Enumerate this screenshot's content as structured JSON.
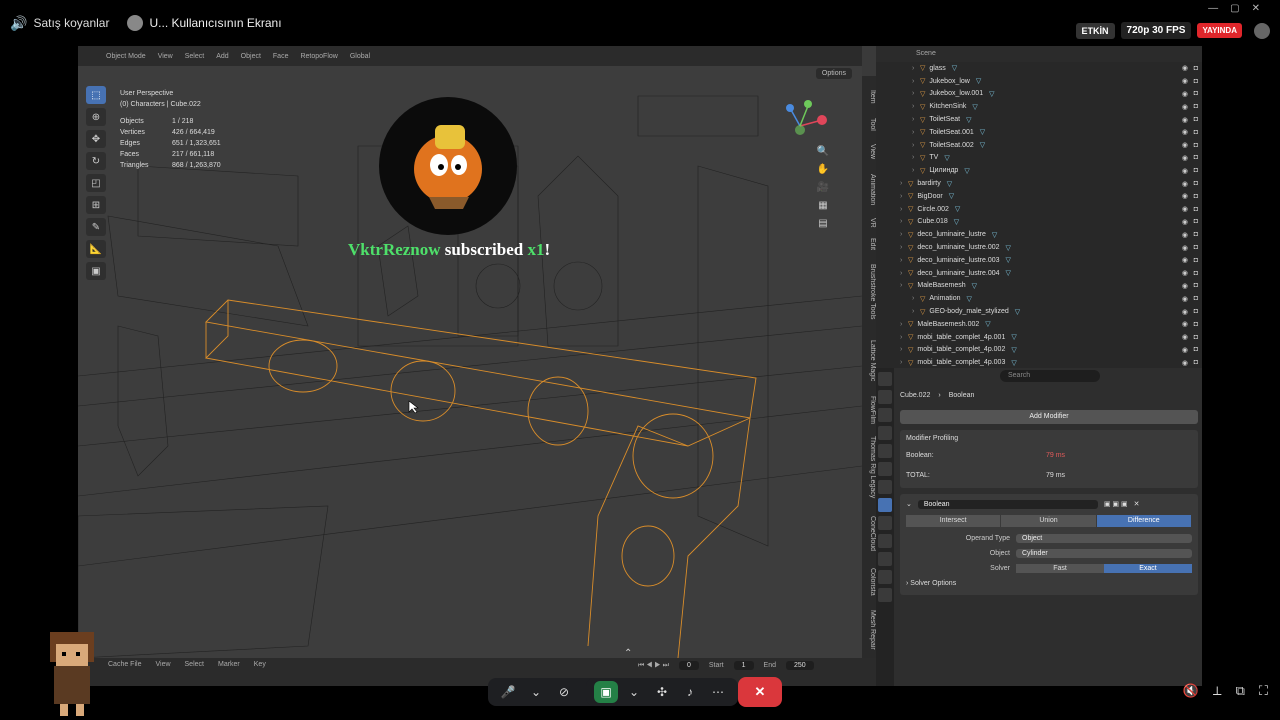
{
  "topbar": {
    "server_name": "Satış koyanlar",
    "stream_title": "U... Kullanıcısının Ekranı",
    "badge_active": "ETKİN",
    "badge_quality": "720p 30 FPS",
    "badge_live": "YAYINDA"
  },
  "viewport": {
    "mode": "Object Mode",
    "menu": [
      "View",
      "Select",
      "Add",
      "Object",
      "Face",
      "RetopoFlow"
    ],
    "transform": "Global",
    "options_label": "Options",
    "perspective": "User Perspective",
    "context": "(0) Characters | Cube.022",
    "stats": [
      {
        "label": "Objects",
        "value": "1 / 218"
      },
      {
        "label": "Vertices",
        "value": "426 / 664,419"
      },
      {
        "label": "Edges",
        "value": "651 / 1,323,651"
      },
      {
        "label": "Faces",
        "value": "217 / 661,118"
      },
      {
        "label": "Triangles",
        "value": "868 / 1,263,870"
      }
    ],
    "side_tabs": [
      "Item",
      "Tool",
      "View",
      "Animation",
      "VR",
      "Edit",
      "Brushstroke Tools",
      "Lattice Magic",
      "FlowFilm",
      "Thomas Rig Legacy",
      "ConeCloud",
      "Colorista",
      "Mesh Repair"
    ]
  },
  "alert": {
    "username": "VktrReznow",
    "message": "subscribed",
    "count": "x1",
    "suffix": "!"
  },
  "timeline": {
    "cache": "Cache File",
    "menu": [
      "View",
      "Select",
      "Marker",
      "Key"
    ],
    "current_frame": "0",
    "start_label": "Start",
    "start": "1",
    "end_label": "End",
    "end": "250"
  },
  "outliner": {
    "search_label": "Scene",
    "items": [
      {
        "name": "glass",
        "indent": 1
      },
      {
        "name": "Jukebox_low",
        "indent": 1
      },
      {
        "name": "Jukebox_low.001",
        "indent": 1
      },
      {
        "name": "KitchenSink",
        "indent": 1
      },
      {
        "name": "ToiletSeat",
        "indent": 1
      },
      {
        "name": "ToiletSeat.001",
        "indent": 1
      },
      {
        "name": "ToiletSeat.002",
        "indent": 1
      },
      {
        "name": "TV",
        "indent": 1
      },
      {
        "name": "Цилиндр",
        "indent": 1
      },
      {
        "name": "bardirty",
        "indent": 0
      },
      {
        "name": "BigDoor",
        "indent": 0
      },
      {
        "name": "Circle.002",
        "indent": 0
      },
      {
        "name": "Cube.018",
        "indent": 0
      },
      {
        "name": "deco_luminaire_lustre",
        "indent": 0
      },
      {
        "name": "deco_luminaire_lustre.002",
        "indent": 0
      },
      {
        "name": "deco_luminaire_lustre.003",
        "indent": 0
      },
      {
        "name": "deco_luminaire_lustre.004",
        "indent": 0
      },
      {
        "name": "MaleBasemesh",
        "indent": 0
      },
      {
        "name": "Animation",
        "indent": 1
      },
      {
        "name": "GEO-body_male_stylized",
        "indent": 1
      },
      {
        "name": "MaleBasemesh.002",
        "indent": 0
      },
      {
        "name": "mobi_table_complet_4p.001",
        "indent": 0
      },
      {
        "name": "mobi_table_complet_4p.002",
        "indent": 0
      },
      {
        "name": "mobi_table_complet_4p.003",
        "indent": 0
      }
    ]
  },
  "properties": {
    "search_placeholder": "Search",
    "object": "Cube.022",
    "modifier_crumb": "Boolean",
    "add_modifier": "Add Modifier",
    "profiling_title": "Modifier Profiling",
    "profiling": [
      {
        "label": "Boolean:",
        "value": "79 ms"
      },
      {
        "label": "TOTAL:",
        "value": "79 ms"
      }
    ],
    "modifier_name": "Boolean",
    "operations": [
      "Intersect",
      "Union",
      "Difference"
    ],
    "selected_operation": "Difference",
    "operand_type_label": "Operand Type",
    "operand_type": "Object",
    "object_label": "Object",
    "object_value": "Cylinder",
    "solver_label": "Solver",
    "solver_options": [
      "Fast",
      "Exact"
    ],
    "selected_solver": "Exact",
    "solver_options_label": "Solver Options"
  }
}
